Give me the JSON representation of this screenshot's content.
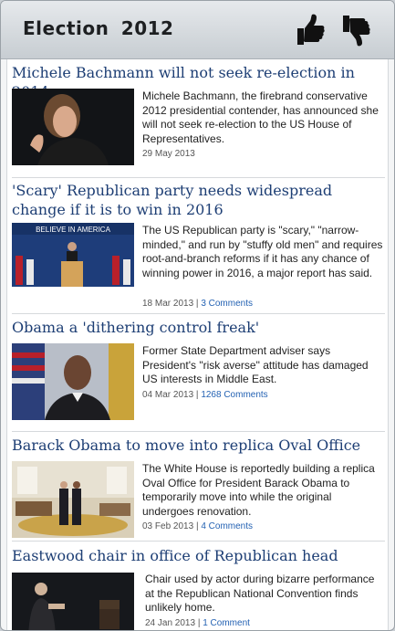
{
  "header": {
    "title": "Election  2012",
    "like_icon": "thumbs-up-icon",
    "dislike_icon": "thumbs-down-icon"
  },
  "articles": [
    {
      "title": "Michele Bachmann will not seek re-election in 2014",
      "summary": "Michele Bachmann, the firebrand conservative 2012 presidential contender, has announced she will not seek re-election to the US House of Representatives.",
      "date": "29 May 2013",
      "comments": ""
    },
    {
      "title": "'Scary' Republican party needs widespread change if it is to win in 2016",
      "summary": "The US Republican party is \"scary,\" \"narrow-minded,\" and run by \"stuffy old men\" and requires root-and-branch reforms if it has any chance of winning power in 2016, a major report has said.",
      "date": "18 Mar 2013",
      "comments": "3 Comments",
      "image_caption": "BELIEVE IN AMERICA"
    },
    {
      "title": "Obama a 'dithering control freak'",
      "summary": "Former State Department adviser says President's \"risk averse\" attitude has damaged US interests in Middle East.",
      "date": "04 Mar 2013",
      "comments": "1268 Comments"
    },
    {
      "title": "Barack Obama to move into replica Oval Office",
      "summary": "The White House is reportedly building a replica Oval Office for President Barack Obama to temporarily move into while the original undergoes renovation.",
      "date": "03 Feb 2013",
      "comments": "4 Comments"
    },
    {
      "title": "Eastwood chair in office of Republican head",
      "summary": "Chair used by actor during bizarre performance at the Republican National Convention finds unlikely home.",
      "date": "24 Jan 2013",
      "comments": "1 Comment"
    }
  ],
  "separator": " | "
}
